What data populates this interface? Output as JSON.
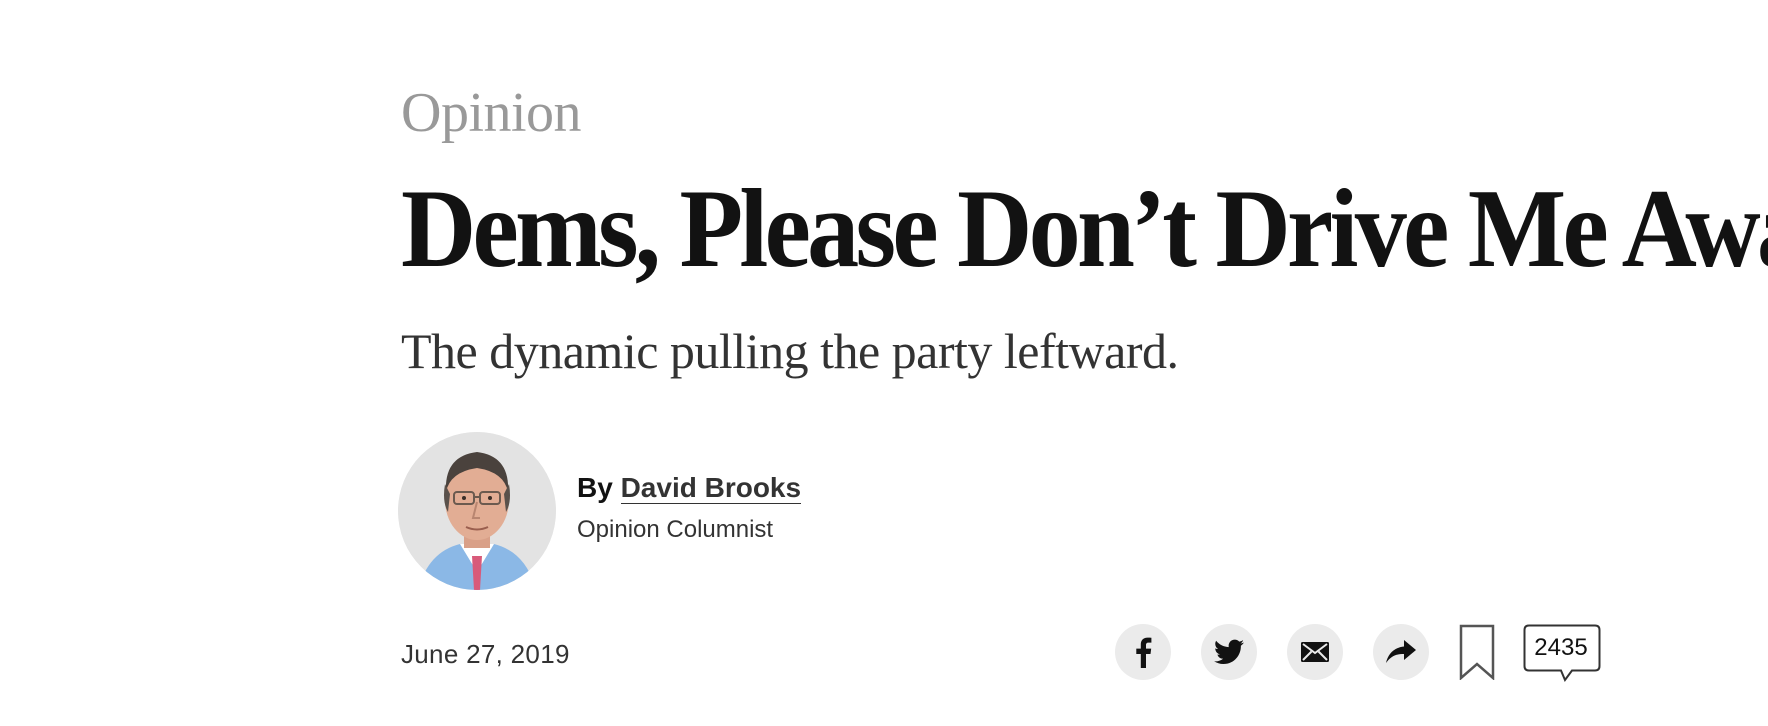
{
  "article": {
    "section": "Opinion",
    "headline": "Dems, Please Don’t Drive Me Away",
    "summary": "The dynamic pulling the party leftward.",
    "byline": {
      "prefix": "By",
      "author": "David Brooks",
      "role": "Opinion Columnist"
    },
    "date": "June 27, 2019"
  },
  "toolbar": {
    "share_icons": [
      "facebook-icon",
      "twitter-icon",
      "email-icon",
      "share-arrow-icon"
    ],
    "save_icon": "bookmark-icon",
    "comment_count": "2435"
  },
  "colors": {
    "section_label": "#999999",
    "headline": "#121212",
    "body_text": "#333333",
    "icon_button_bg": "#ebebeb"
  }
}
